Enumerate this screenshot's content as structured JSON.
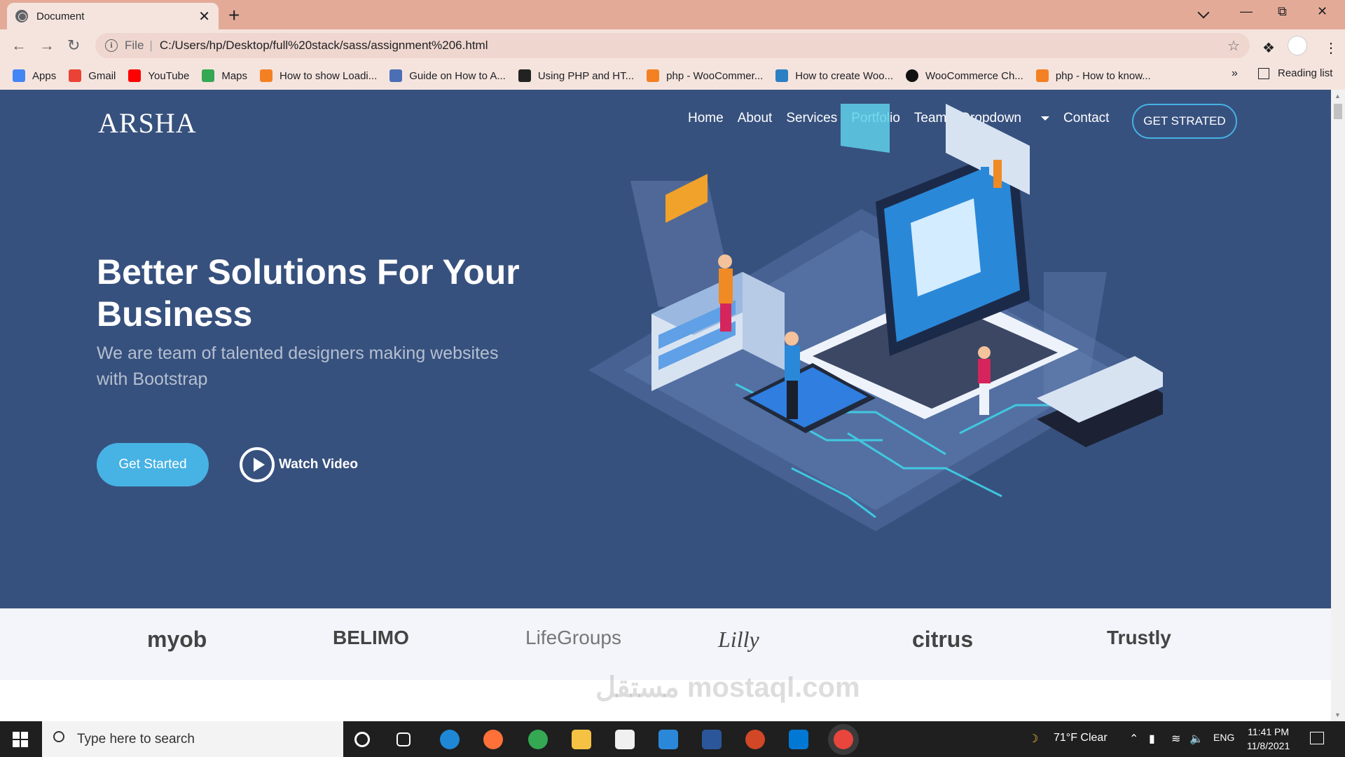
{
  "browser": {
    "tab_title": "Document",
    "tab_close": "✕",
    "new_tab": "+",
    "address_prefix": "File",
    "url": "C:/Users/hp/Desktop/full%20stack/sass/assignment%206.html",
    "bookmarks": [
      {
        "label": "Apps",
        "color": "#4285f4"
      },
      {
        "label": "Gmail",
        "color": "#ea4335"
      },
      {
        "label": "YouTube",
        "color": "#ff0000"
      },
      {
        "label": "Maps",
        "color": "#34a853"
      },
      {
        "label": "How to show Loadi...",
        "color": "#f48024"
      },
      {
        "label": "Guide on How to A...",
        "color": "#4a6fb5"
      },
      {
        "label": "Using PHP and HT...",
        "color": "#222222"
      },
      {
        "label": "php - WooCommer...",
        "color": "#f48024"
      },
      {
        "label": "How to create Woo...",
        "color": "#2b7fc3"
      },
      {
        "label": "WooCommerce Ch...",
        "color": "#111111"
      },
      {
        "label": "php - How to know...",
        "color": "#f48024"
      }
    ],
    "more_bookmarks": "»",
    "reading_list": "Reading list"
  },
  "page": {
    "logo": "ARSHA",
    "nav": {
      "home": "Home",
      "about": "About",
      "services": "Services",
      "portfolio": "Portfolio",
      "team": "Team",
      "dropdown": "Dropdown",
      "contact": "Contact"
    },
    "cta_header": "GET STRATED",
    "headline": "Better Solutions For Your Business",
    "subheadline": "We are team of talented designers making websites with Bootstrap",
    "get_started": "Get Started",
    "watch_video": "Watch Video",
    "clients": [
      "myob",
      "BELIMO",
      "LifeGroups",
      "Lilly",
      "citrus",
      "Trustly"
    ],
    "colors": {
      "hero_bg": "#37517e",
      "accent": "#47b2e4",
      "clients_bg": "#f3f5fa"
    }
  },
  "taskbar": {
    "search_placeholder": "Type here to search",
    "weather": "71°F  Clear",
    "language": "ENG",
    "time": "11:41 PM",
    "date": "11/8/2021"
  },
  "watermark": "مستقل mostaql.com"
}
